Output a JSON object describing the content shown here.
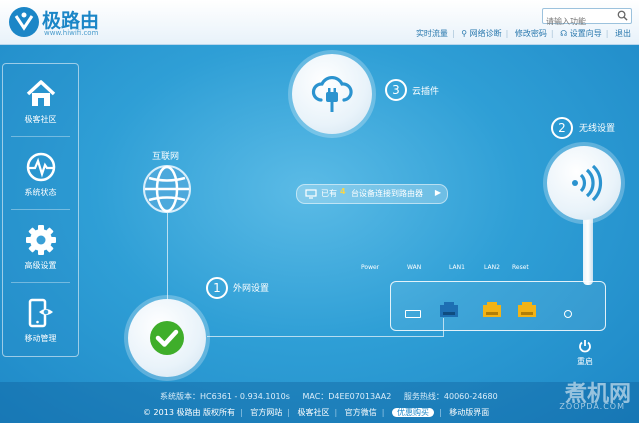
{
  "header": {
    "brand": "极路由",
    "brand_url": "www.hiwifi.com",
    "search_placeholder": "请输入功能",
    "nav": [
      "实时流量",
      "网络诊断",
      "修改密码",
      "设置向导",
      "退出"
    ]
  },
  "sidebar": {
    "items": [
      {
        "label": "极客社区",
        "icon": "home-icon"
      },
      {
        "label": "系统状态",
        "icon": "heartbeat-icon"
      },
      {
        "label": "高级设置",
        "icon": "gear-icon"
      },
      {
        "label": "移动管理",
        "icon": "mobile-icon"
      }
    ]
  },
  "main": {
    "internet_label": "互联网",
    "step1": {
      "num": "1",
      "label": "外网设置"
    },
    "step2": {
      "num": "2",
      "label": "无线设置"
    },
    "step3": {
      "num": "3",
      "label": "云插件"
    },
    "status_prefix": "已有",
    "device_count": "4",
    "status_suffix": "台设备连接到路由器",
    "ports": [
      "Power",
      "WAN",
      "LAN1",
      "LAN2",
      "Reset"
    ],
    "reboot_label": "重启"
  },
  "footer": {
    "version": "系统版本：HC6361 - 0.934.1010s",
    "mac": "MAC：D4EE07013AA2",
    "hotline": "服务热线：40060-24680",
    "copyright": "© 2013 极路由 版权所有",
    "links": [
      "官方网站",
      "极客社区",
      "官方微信",
      "优惠购买",
      "移动版界面"
    ]
  },
  "watermark": {
    "text": "煮机网",
    "sub": "ZOOPDA.COM"
  },
  "colors": {
    "accent": "#1b86c7",
    "check_green": "#3fae2a",
    "port_yellow": "#f2b316",
    "port_blue": "#1d6fb3"
  }
}
